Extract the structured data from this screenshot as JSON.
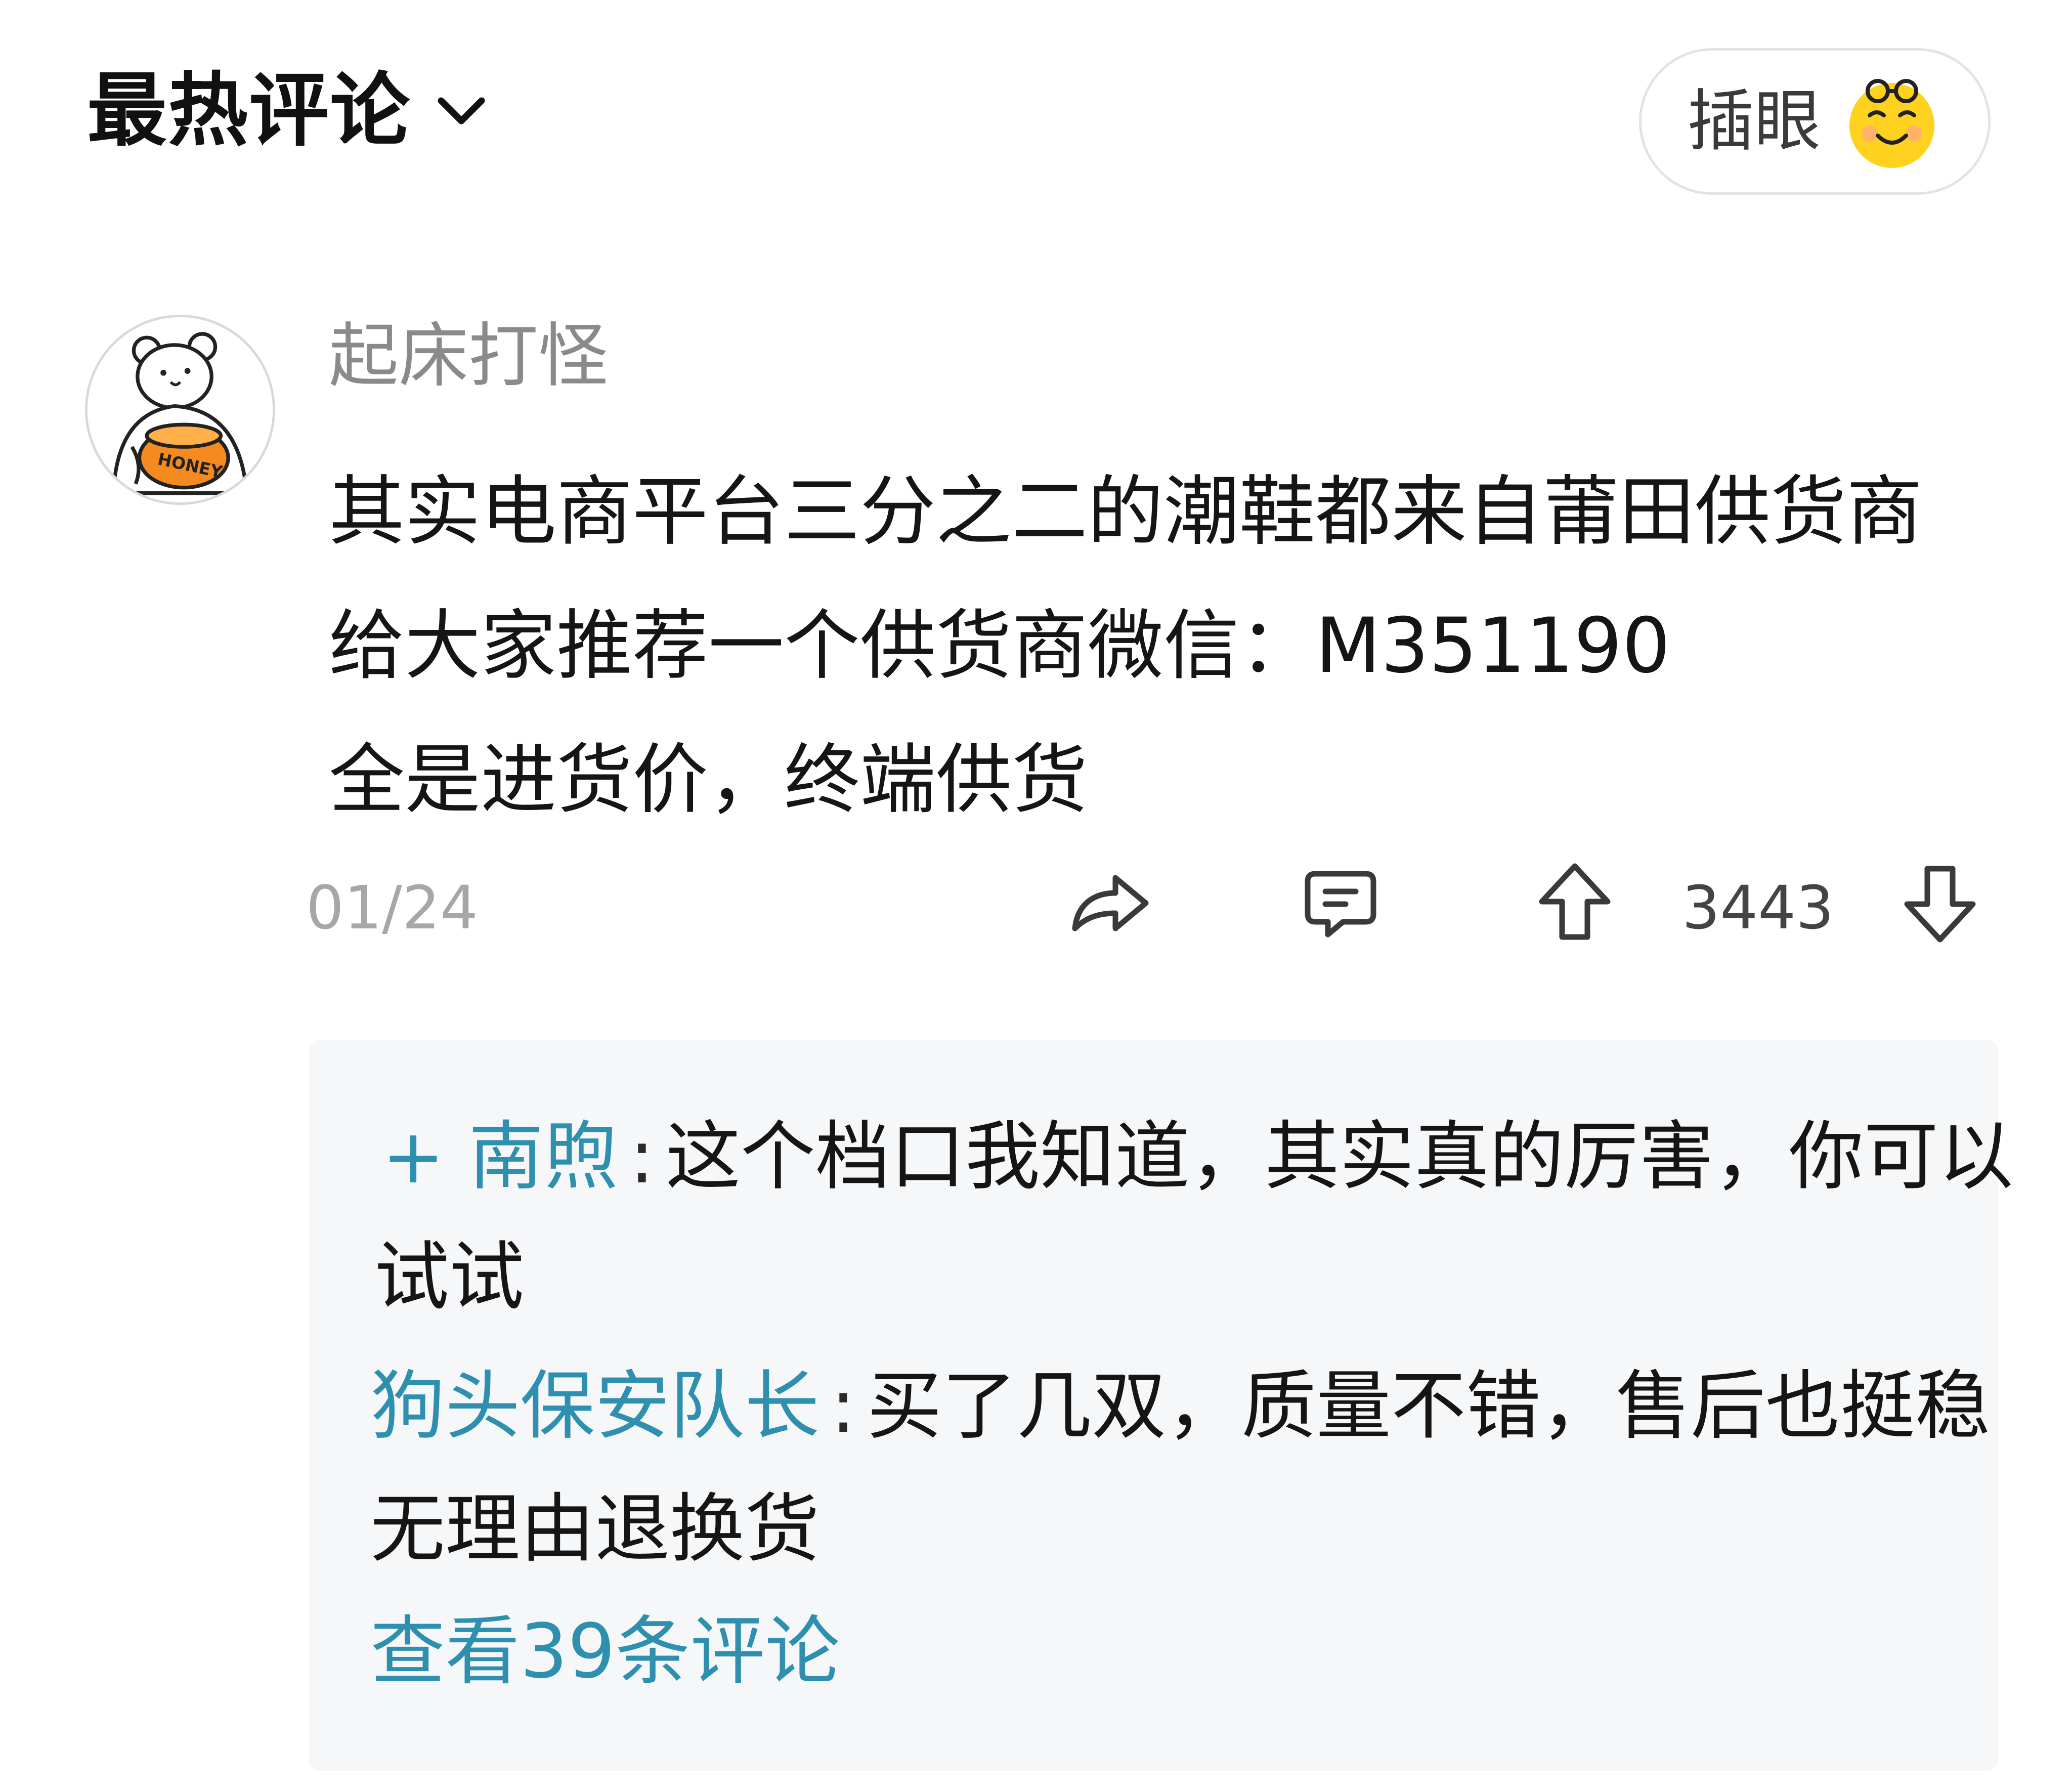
{
  "header": {
    "title": "最热评论",
    "sort_icon": "chevron-down-icon",
    "insert_button_label": "插眼",
    "insert_button_icon": "smiling-glasses-emoji-icon"
  },
  "comment": {
    "avatar_icon": "bear-honey-pot-avatar",
    "avatar_text": "HONEY",
    "username": "起床打怪",
    "body_lines": [
      "其实电商平台三分之二的潮鞋都来自莆田供货商",
      "给大家推荐一个供货商微信：M351190",
      "全是进货价，终端供货"
    ],
    "date": "01/24",
    "vote_count": "3443",
    "icons": {
      "share": "share-arrow-icon",
      "reply": "comment-bubble-icon",
      "upvote": "arrow-up-icon",
      "downvote": "arrow-down-icon"
    }
  },
  "replies": {
    "items": [
      {
        "author": "+ 南煦",
        "separator": ":",
        "text_line1": "这个档口我知道，其实真的厉害，你可以",
        "text_line2": "试试"
      },
      {
        "author": "狗头保安队长",
        "separator": ":",
        "text_line1": "买了几双，质量不错，售后也挺稳",
        "text_line2": "无理由退换货"
      }
    ],
    "view_more": "查看39条评论"
  },
  "colors": {
    "link_blue": "#2e8fae",
    "muted_gray": "#8a8a8a",
    "panel_bg": "#f6f7f9"
  }
}
